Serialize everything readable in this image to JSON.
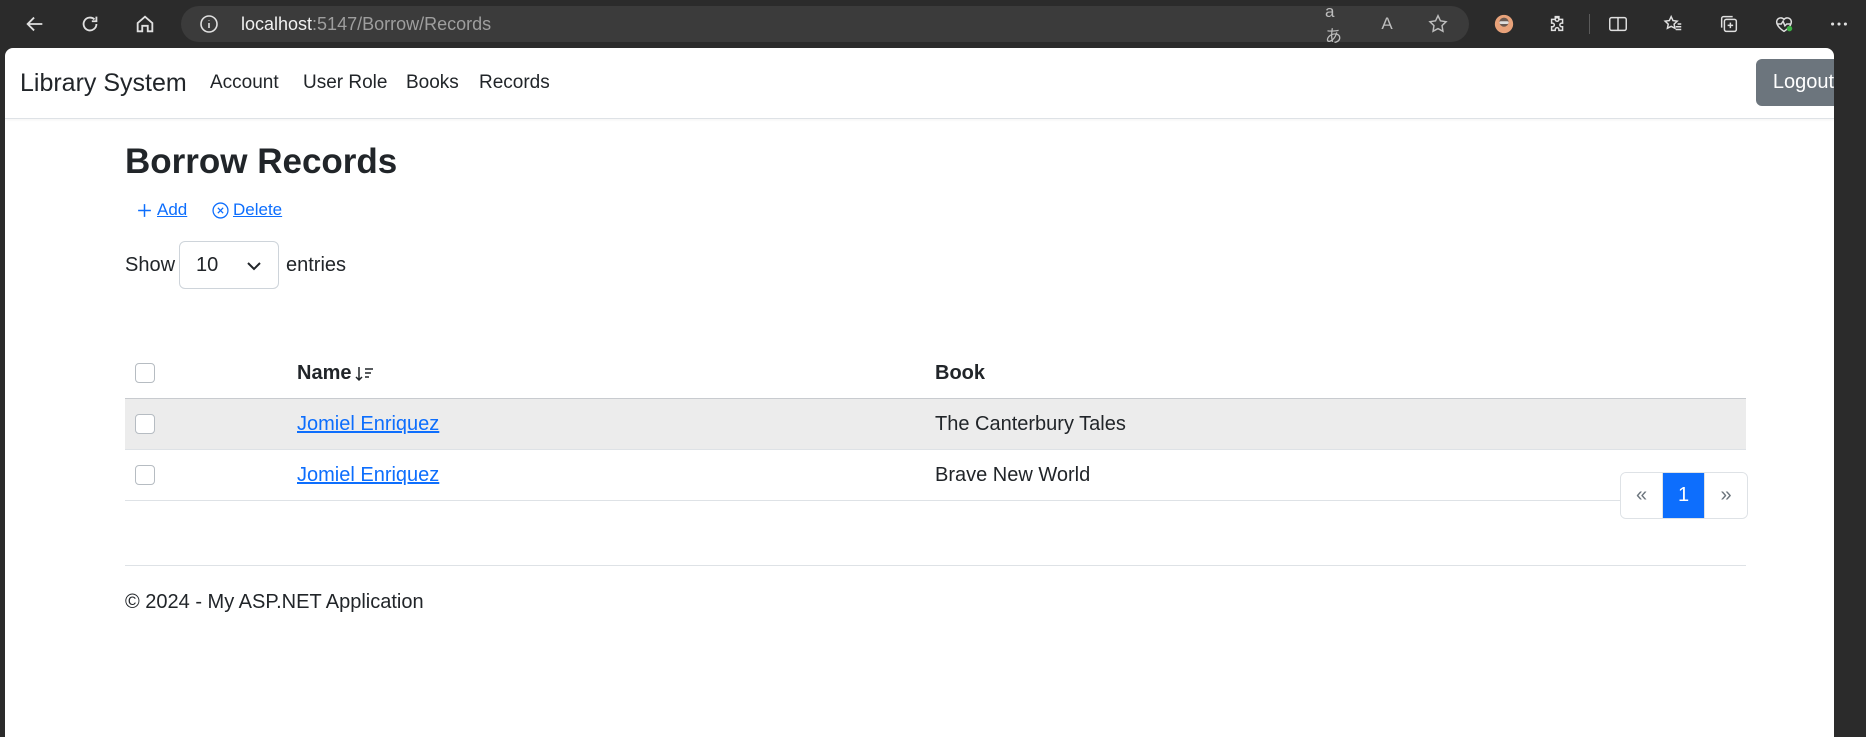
{
  "browser": {
    "url_host": "localhost",
    "url_path": ":5147/Borrow/Records",
    "translate_icon_glyph": "aあ",
    "read_aloud_icon_glyph": "A"
  },
  "navbar": {
    "brand": "Library System",
    "links": [
      "Account",
      "User Role",
      "Books",
      "Records"
    ],
    "logout_label": "Logout"
  },
  "page": {
    "title": "Borrow Records",
    "add_label": "Add",
    "delete_label": "Delete",
    "show_label": "Show",
    "entries_value": "10",
    "entries_label": "entries"
  },
  "table": {
    "columns": [
      "Name",
      "Book"
    ],
    "rows": [
      {
        "name": "Jomiel Enriquez",
        "book": "The Canterbury Tales"
      },
      {
        "name": "Jomiel Enriquez",
        "book": "Brave New World"
      }
    ]
  },
  "pagination": {
    "prev": "«",
    "current": "1",
    "next": "»"
  },
  "footer": {
    "text": "© 2024 - My ASP.NET Application"
  },
  "colors": {
    "primary": "#0d6efd",
    "secondary": "#6c757d",
    "striped_row": "#ececec"
  }
}
